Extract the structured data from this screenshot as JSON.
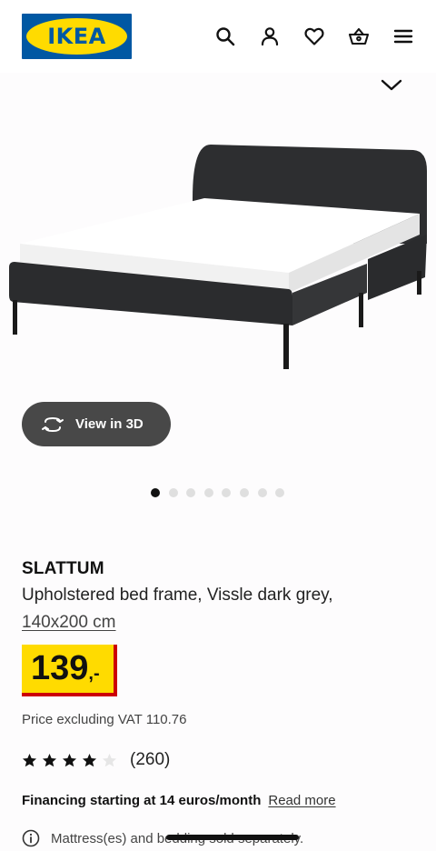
{
  "header": {
    "logo_text": "IKEA",
    "icons": [
      "search-icon",
      "account-icon",
      "heart-icon",
      "basket-icon",
      "menu-icon"
    ]
  },
  "gallery": {
    "view_3d_label": "View in 3D",
    "dot_count": 8,
    "active_dot": 1
  },
  "product": {
    "brand": "SLATTUM",
    "description": "Upholstered bed frame, Vissle dark grey,",
    "size": "140x200 cm",
    "price_integer": "139",
    "price_suffix": ",-",
    "vat_text": "Price excluding VAT 110.76",
    "rating_value": 4,
    "rating_max": 5,
    "rating_count": "(260)",
    "financing_text": "Financing starting at 14 euros/month",
    "read_more": "Read more",
    "notice": "Mattress(es) and bedding sold separately."
  },
  "colors": {
    "ikea_blue": "#0058a3",
    "ikea_yellow": "#ffdb00",
    "price_red": "#cc0008",
    "button_dark": "#484848"
  }
}
